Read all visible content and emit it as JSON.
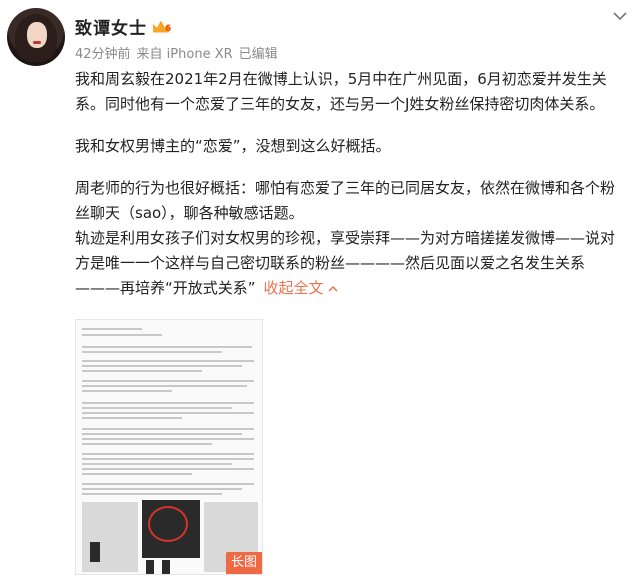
{
  "author": {
    "name": "致谭女士",
    "badge_icon": "vip-crown-icon"
  },
  "meta": {
    "time": "42分钟前",
    "source": "来自 iPhone XR",
    "edited": "已编辑"
  },
  "more_icon": "chevron-down-icon",
  "content": {
    "paragraph1": "我和周玄毅在2021年2月在微博上认识，5月中在广州见面，6月初恋爱并发生关系。同时他有一个恋爱了三年的女友，还与另一个J姓女粉丝保持密切肉体关系。",
    "paragraph2": "我和女权男博主的“恋爱”，没想到这么好概括。",
    "paragraph3": "周老师的行为也很好概括：哪怕有恋爱了三年的已同居女友，依然在微博和各个粉丝聊天（sao），聊各种敏感话题。",
    "paragraph4": "轨迹是利用女孩子们对女权男的珍视，享受崇拜——为对方暗搓搓发微博——说对方是唯一一个这样与自己密切联系的粉丝————然后见面以爱之名发生关系———再培养“开放式关系”",
    "expand_label": "收起全文"
  },
  "image": {
    "badge_label": "长图"
  }
}
